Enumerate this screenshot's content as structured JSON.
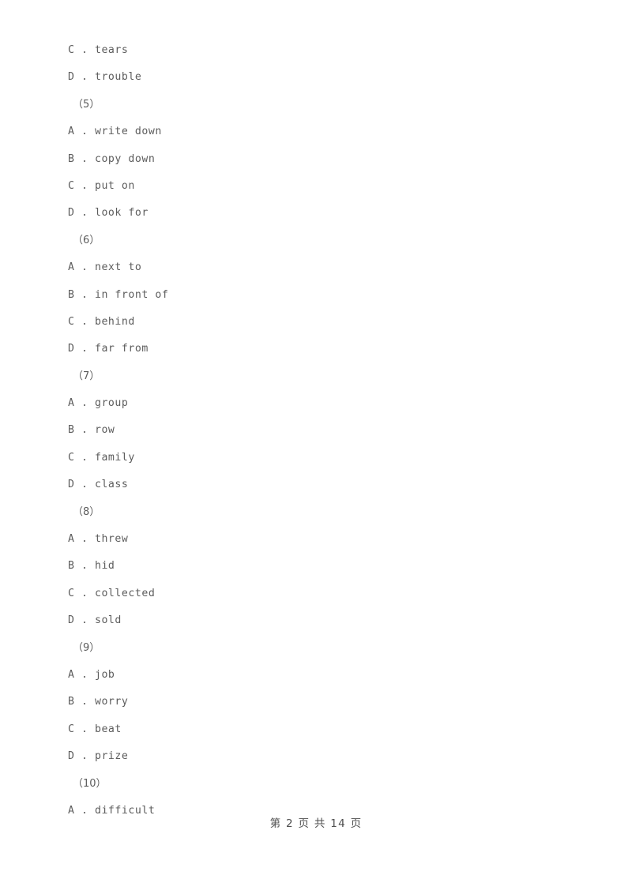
{
  "document": {
    "type": "exam-paper-page",
    "language": "zh-CN",
    "body_lines": [
      {
        "kind": "option",
        "text": "C . tears"
      },
      {
        "kind": "option",
        "text": "D . trouble"
      },
      {
        "kind": "qnum",
        "text": "（5）"
      },
      {
        "kind": "option",
        "text": "A . write down"
      },
      {
        "kind": "option",
        "text": "B . copy down"
      },
      {
        "kind": "option",
        "text": "C . put on"
      },
      {
        "kind": "option",
        "text": "D . look for"
      },
      {
        "kind": "qnum",
        "text": "（6）"
      },
      {
        "kind": "option",
        "text": "A . next to"
      },
      {
        "kind": "option",
        "text": "B . in front of"
      },
      {
        "kind": "option",
        "text": "C . behind"
      },
      {
        "kind": "option",
        "text": "D . far from"
      },
      {
        "kind": "qnum",
        "text": "（7）"
      },
      {
        "kind": "option",
        "text": "A . group"
      },
      {
        "kind": "option",
        "text": "B . row"
      },
      {
        "kind": "option",
        "text": "C . family"
      },
      {
        "kind": "option",
        "text": "D . class"
      },
      {
        "kind": "qnum",
        "text": "（8）"
      },
      {
        "kind": "option",
        "text": "A . threw"
      },
      {
        "kind": "option",
        "text": "B . hid"
      },
      {
        "kind": "option",
        "text": "C . collected"
      },
      {
        "kind": "option",
        "text": "D . sold"
      },
      {
        "kind": "qnum",
        "text": "（9）"
      },
      {
        "kind": "option",
        "text": "A . job"
      },
      {
        "kind": "option",
        "text": "B . worry"
      },
      {
        "kind": "option",
        "text": "C . beat"
      },
      {
        "kind": "option",
        "text": "D . prize"
      },
      {
        "kind": "qnum",
        "text": "（10）"
      },
      {
        "kind": "option",
        "text": "A . difficult"
      }
    ],
    "footer": {
      "text": "第 2 页 共 14 页",
      "current_page": "2",
      "total_pages": "14"
    },
    "colors": {
      "background": "#ffffff",
      "body_text": "#5c5c5c",
      "footer_text": "#4e4e4e"
    }
  }
}
